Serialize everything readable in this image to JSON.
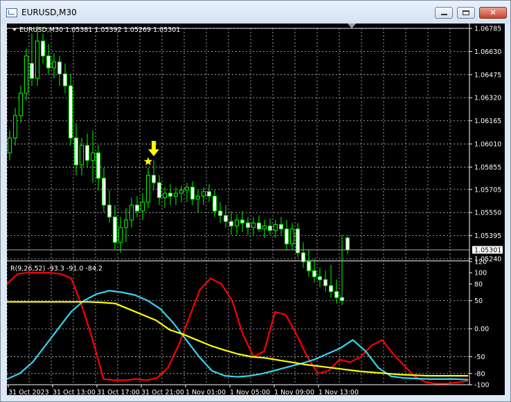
{
  "window": {
    "title": "EURUSD,M30",
    "controls": {
      "minimize": "minimize",
      "maximize": "maximize",
      "close": "close"
    }
  },
  "main": {
    "info": "EURUSD,M30  1.05381 1.05392 1.05269 1.05301",
    "price_labels": [
      "1.06785",
      "1.06630",
      "1.06475",
      "1.06320",
      "1.06165",
      "1.06010",
      "1.05855",
      "1.05705",
      "1.05550",
      "1.05395",
      "1.05240"
    ],
    "current_price": "1.05301",
    "colors": {
      "bull": "#00ff00",
      "bear": "#00ff00",
      "star": "#ffff00",
      "arrow": "#ffff00",
      "price_tag": "#ffffff"
    }
  },
  "indicator": {
    "title": "R(9,26,52) -93.3 -91.0 -84.2",
    "levels": [
      "120",
      "100",
      "80",
      "50",
      "0.00",
      "-50",
      "-80",
      "-100"
    ],
    "colors": {
      "red": "#ff0000",
      "cyan": "#33d6f0",
      "yellow": "#ffff00"
    }
  },
  "time_labels": [
    "31 Oct 2023",
    "31 Oct 13:00",
    "31 Oct 17:00",
    "31 Oct 21:00",
    "1 Nov 01:00",
    "1 Nov 05:00",
    "1 Nov 09:00",
    "1 Nov 13:00"
  ],
  "chart_data": {
    "type": "candlestick",
    "symbol": "EURUSD",
    "timeframe": "M30",
    "ohlc_last": [
      1.05381,
      1.05392,
      1.05269,
      1.05301
    ],
    "price_range": [
      1.0524,
      1.06785
    ],
    "candles": [
      [
        1.0595,
        1.061,
        1.059,
        1.0605
      ],
      [
        1.0605,
        1.0625,
        1.06,
        1.062
      ],
      [
        1.062,
        1.064,
        1.0615,
        1.0635
      ],
      [
        1.0635,
        1.0665,
        1.063,
        1.066
      ],
      [
        1.0655,
        1.0675,
        1.064,
        1.0645
      ],
      [
        1.0645,
        1.068,
        1.064,
        1.067
      ],
      [
        1.067,
        1.0675,
        1.0655,
        1.066
      ],
      [
        1.066,
        1.0668,
        1.0648,
        1.0652
      ],
      [
        1.0652,
        1.0662,
        1.0645,
        1.0656
      ],
      [
        1.0656,
        1.066,
        1.064,
        1.0648
      ],
      [
        1.0648,
        1.0655,
        1.0635,
        1.064
      ],
      [
        1.064,
        1.0648,
        1.06,
        1.0605
      ],
      [
        1.0605,
        1.0615,
        1.058,
        1.0587
      ],
      [
        1.0587,
        1.0605,
        1.058,
        1.06
      ],
      [
        1.06,
        1.0608,
        1.0585,
        1.059
      ],
      [
        1.059,
        1.061,
        1.0575,
        1.0595
      ],
      [
        1.0595,
        1.06,
        1.057,
        1.0578
      ],
      [
        1.0578,
        1.0585,
        1.0555,
        1.056
      ],
      [
        1.056,
        1.057,
        1.0548,
        1.0552
      ],
      [
        1.0552,
        1.056,
        1.053,
        1.0535
      ],
      [
        1.0535,
        1.0552,
        1.0528,
        1.0545
      ],
      [
        1.0545,
        1.0558,
        1.0535,
        1.055
      ],
      [
        1.055,
        1.0565,
        1.0545,
        1.056
      ],
      [
        1.056,
        1.0566,
        1.0552,
        1.0556
      ],
      [
        1.0556,
        1.0568,
        1.055,
        1.0562
      ],
      [
        1.0562,
        1.0585,
        1.0558,
        1.058
      ],
      [
        1.058,
        1.059,
        1.057,
        1.0575
      ],
      [
        1.0575,
        1.058,
        1.056,
        1.0565
      ],
      [
        1.0565,
        1.0572,
        1.0558,
        1.0568
      ],
      [
        1.0568,
        1.0574,
        1.056,
        1.0566
      ],
      [
        1.0566,
        1.0572,
        1.056,
        1.0568
      ],
      [
        1.0568,
        1.0573,
        1.0562,
        1.057
      ],
      [
        1.057,
        1.0575,
        1.0562,
        1.0572
      ],
      [
        1.0572,
        1.0576,
        1.056,
        1.0564
      ],
      [
        1.0564,
        1.057,
        1.0555,
        1.0566
      ],
      [
        1.0566,
        1.0572,
        1.056,
        1.0569
      ],
      [
        1.0569,
        1.0574,
        1.0562,
        1.0566
      ],
      [
        1.0566,
        1.057,
        1.0552,
        1.0556
      ],
      [
        1.0556,
        1.0562,
        1.0548,
        1.0553
      ],
      [
        1.0553,
        1.056,
        1.0545,
        1.0549
      ],
      [
        1.0549,
        1.0556,
        1.054,
        1.0546
      ],
      [
        1.0546,
        1.0554,
        1.054,
        1.055
      ],
      [
        1.055,
        1.0556,
        1.0542,
        1.0548
      ],
      [
        1.0548,
        1.0552,
        1.054,
        1.0545
      ],
      [
        1.0545,
        1.0552,
        1.054,
        1.0548
      ],
      [
        1.0548,
        1.0553,
        1.0542,
        1.0544
      ],
      [
        1.0544,
        1.055,
        1.0538,
        1.0546
      ],
      [
        1.0546,
        1.0551,
        1.054,
        1.0543
      ],
      [
        1.0543,
        1.055,
        1.0538,
        1.0547
      ],
      [
        1.0547,
        1.0552,
        1.054,
        1.0544
      ],
      [
        1.0544,
        1.055,
        1.053,
        1.0534
      ],
      [
        1.0534,
        1.0548,
        1.053,
        1.0544
      ],
      [
        1.0544,
        1.0548,
        1.0525,
        1.0528
      ],
      [
        1.0528,
        1.0535,
        1.0518,
        1.0522
      ],
      [
        1.0522,
        1.053,
        1.0512,
        1.0516
      ],
      [
        1.0516,
        1.0524,
        1.0508,
        1.0512
      ],
      [
        1.0512,
        1.0518,
        1.0505,
        1.051
      ],
      [
        1.051,
        1.0516,
        1.0502,
        1.0506
      ],
      [
        1.0506,
        1.052,
        1.0498,
        1.0502
      ],
      [
        1.0502,
        1.051,
        1.0494,
        1.0498
      ],
      [
        1.0498,
        1.054,
        1.0493,
        1.0496
      ],
      [
        1.0538,
        1.0539,
        1.0527,
        1.053
      ]
    ],
    "markers": [
      {
        "type": "star",
        "candle": 25
      },
      {
        "type": "arrow-down",
        "candle": 26
      }
    ],
    "indicator": {
      "name": "R(9,26,52)",
      "values": [
        -93.3,
        -91.0,
        -84.2
      ],
      "levels": [
        120,
        100,
        80,
        50,
        0,
        -50,
        -80,
        -100
      ],
      "series": [
        {
          "color": "#ff0000",
          "values": [
            80,
            98,
            100,
            100,
            100,
            98,
            90,
            40,
            -20,
            -90,
            -92,
            -92,
            -90,
            -92,
            -88,
            -70,
            -30,
            20,
            70,
            90,
            80,
            50,
            -10,
            -50,
            -40,
            30,
            25,
            -10,
            -50,
            -80,
            -75,
            -55,
            -60,
            -50,
            -30,
            -20,
            -45,
            -65,
            -85,
            -95,
            -98,
            -98,
            -96,
            -93
          ]
        },
        {
          "color": "#33d6f0",
          "values": [
            -90,
            -80,
            -60,
            -30,
            0,
            30,
            50,
            62,
            68,
            65,
            60,
            50,
            35,
            10,
            -20,
            -50,
            -75,
            -84,
            -86,
            -84,
            -80,
            -74,
            -68,
            -62,
            -55,
            -45,
            -35,
            -20,
            -40,
            -70,
            -85,
            -88,
            -89,
            -90,
            -90,
            -90,
            -91
          ]
        },
        {
          "color": "#ffff00",
          "values": [
            48,
            48,
            48,
            48,
            48,
            48,
            48,
            47,
            45,
            35,
            25,
            15,
            -2,
            -10,
            -20,
            -30,
            -38,
            -45,
            -50,
            -52,
            -56,
            -60,
            -64,
            -67,
            -70,
            -73,
            -76,
            -78,
            -80,
            -82,
            -83,
            -84,
            -84,
            -84,
            -84
          ]
        }
      ]
    },
    "time_labels": [
      "31 Oct 2023",
      "31 Oct 13:00",
      "31 Oct 17:00",
      "31 Oct 21:00",
      "1 Nov 01:00",
      "1 Nov 05:00",
      "1 Nov 09:00",
      "1 Nov 13:00"
    ]
  }
}
